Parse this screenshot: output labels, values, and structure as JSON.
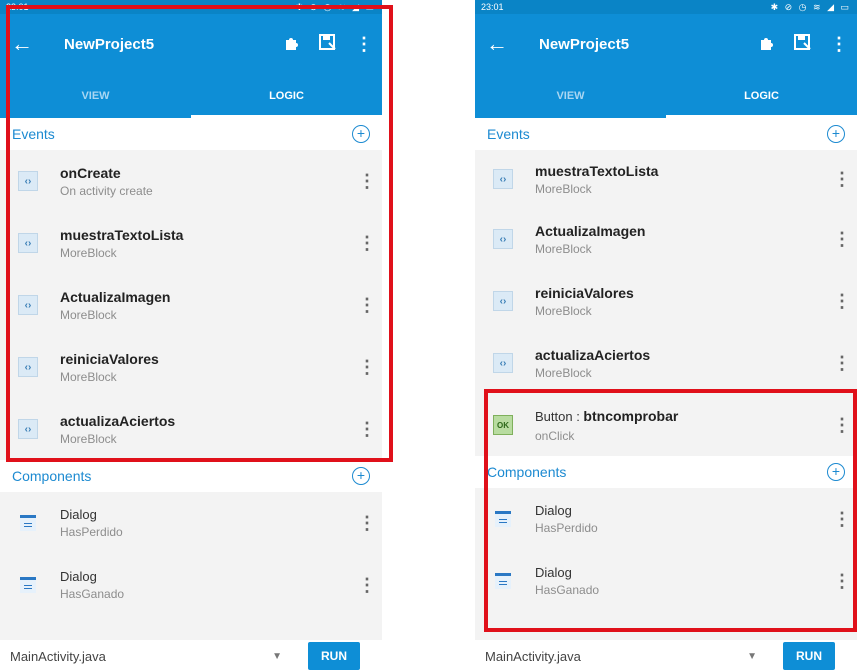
{
  "status": {
    "time": "23:01",
    "icons": "✱ ⊘ ◷ ≋ ◢ ▭"
  },
  "appbar": {
    "title": "NewProject5"
  },
  "tabs": [
    {
      "label": "VIEW"
    },
    {
      "label": "LOGIC"
    }
  ],
  "sections": {
    "events": "Events",
    "components": "Components"
  },
  "left": {
    "events": [
      {
        "title": "onCreate",
        "subtitle": "On activity create"
      },
      {
        "title": "muestraTextoLista",
        "subtitle": "MoreBlock"
      },
      {
        "title": "ActualizaImagen",
        "subtitle": "MoreBlock"
      },
      {
        "title": "reiniciaValores",
        "subtitle": "MoreBlock"
      },
      {
        "title": "actualizaAciertos",
        "subtitle": "MoreBlock"
      }
    ],
    "components": [
      {
        "title": "Dialog",
        "subtitle": "HasPerdido"
      },
      {
        "title": "Dialog",
        "subtitle": "HasGanado"
      }
    ]
  },
  "right": {
    "events": [
      {
        "title": "muestraTextoLista",
        "subtitle": "MoreBlock"
      },
      {
        "title": "ActualizaImagen",
        "subtitle": "MoreBlock"
      },
      {
        "title": "reiniciaValores",
        "subtitle": "MoreBlock"
      },
      {
        "title": "actualizaAciertos",
        "subtitle": "MoreBlock"
      }
    ],
    "button_event": {
      "prefix": "Button : ",
      "name": "btncomprobar",
      "subtitle": "onClick",
      "icon_text": "OK"
    },
    "components": [
      {
        "title": "Dialog",
        "subtitle": "HasPerdido"
      },
      {
        "title": "Dialog",
        "subtitle": "HasGanado"
      }
    ]
  },
  "footer": {
    "file": "MainActivity.java",
    "run": "RUN"
  },
  "colors": {
    "primary": "#0e8ed6",
    "accent": "#1c8ad1",
    "highlight": "#e0101a"
  }
}
